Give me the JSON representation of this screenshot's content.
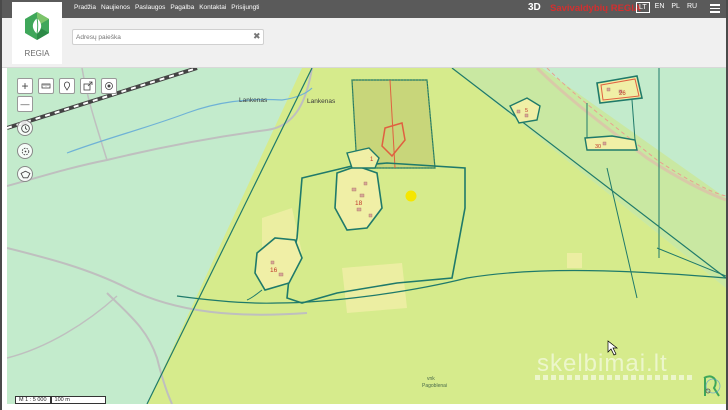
{
  "nav": [
    "Pradžia",
    "Naujienos",
    "Paslaugos",
    "Pagalba",
    "Kontaktai",
    "Prisijungti"
  ],
  "brand": {
    "mode_3d": "3D",
    "name": "Savivaldybių REGIA"
  },
  "languages": [
    {
      "code": "LT",
      "active": true
    },
    {
      "code": "EN",
      "active": false
    },
    {
      "code": "PL",
      "active": false
    },
    {
      "code": "RU",
      "active": false
    }
  ],
  "logo": {
    "text": "REGIA"
  },
  "search": {
    "placeholder": "Adresų paieška",
    "clear_icon": "close-icon"
  },
  "tools": {
    "zoom_in": "+",
    "zoom_out": "—",
    "icons": [
      "ruler-icon",
      "pin-icon",
      "export-icon",
      "target-icon",
      "history-icon",
      "locate-icon",
      "polygon-icon",
      "gear-icon"
    ]
  },
  "map": {
    "labels": {
      "road_1": "Lankenas",
      "road_2": "Lankenas",
      "place": "Pagoblenai",
      "place_prefix": "vnk"
    },
    "parcels": [
      "18",
      "16",
      "1",
      "5",
      "26",
      "30"
    ],
    "colors": {
      "grass": "#c3ebcc",
      "field": "#d6eb8c",
      "light_field": "#f2f2a8",
      "parcel_border": "#1f7a6a",
      "road": "#bfbfbf",
      "red_boundary": "#e06040",
      "stream": "#6fb2d6",
      "marker": "#f5e600"
    }
  },
  "scale": {
    "ratio": "M 1 : 5 000",
    "distance": "100 m"
  },
  "watermark": "skelbimai.lt"
}
